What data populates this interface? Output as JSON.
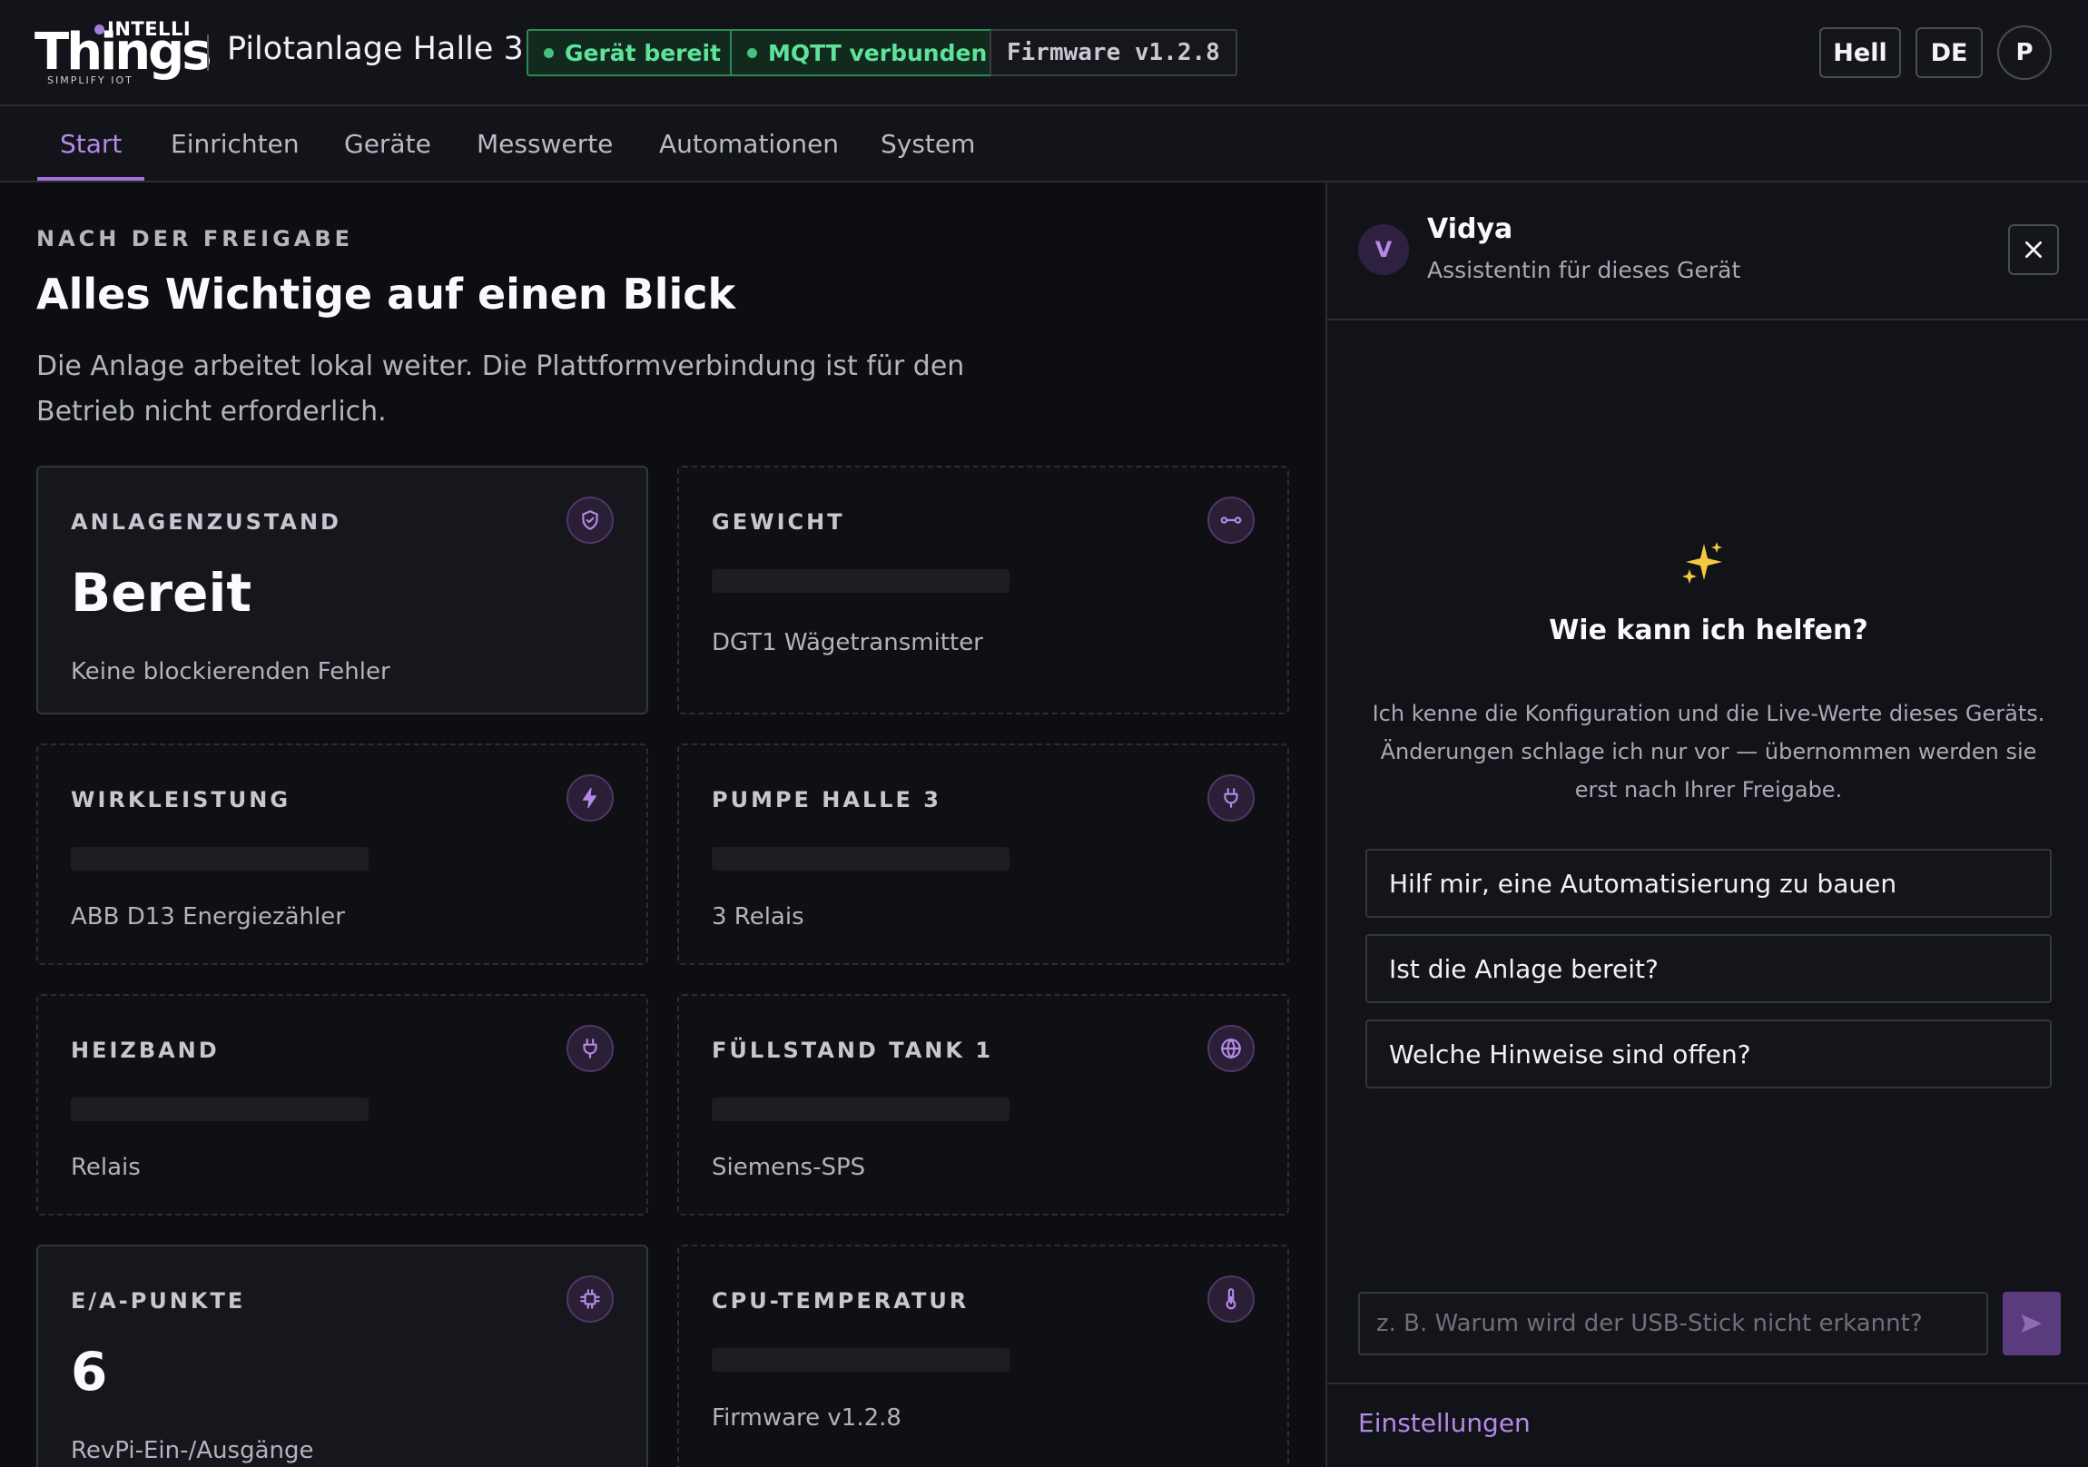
{
  "brand": {
    "top": "INTELLI",
    "main": "Things",
    "tagline": "SIMPLIFY IOT"
  },
  "header": {
    "title": "Pilotanlage Halle 3",
    "status_device": "Gerät bereit",
    "status_mqtt": "MQTT verbunden",
    "firmware": "Firmware v1.2.8",
    "theme_label": "Hell",
    "language_label": "DE",
    "user_initial": "P",
    "status_color": "#5ee39a",
    "accent_color": "#b48ae8"
  },
  "nav": {
    "tabs": [
      {
        "label": "Start",
        "active": true
      },
      {
        "label": "Einrichten",
        "active": false
      },
      {
        "label": "Geräte",
        "active": false
      },
      {
        "label": "Messwerte",
        "active": false
      },
      {
        "label": "Automationen",
        "active": false
      },
      {
        "label": "System",
        "active": false
      }
    ]
  },
  "overview": {
    "eyebrow": "NACH DER FREIGABE",
    "headline": "Alles Wichtige auf einen Blick",
    "lead": "Die Anlage arbeitet lokal weiter. Die Plattformverbindung ist für den Betrieb nicht erforderlich.",
    "cards": [
      {
        "title": "ANLAGENZUSTAND",
        "value": "Bereit",
        "subtitle": "Keine blockierenden Fehler",
        "icon": "shield-icon"
      },
      {
        "title": "GEWICHT",
        "value": "",
        "subtitle": "DGT1 Wägetransmitter",
        "icon": "scale-icon"
      },
      {
        "title": "WIRKLEISTUNG",
        "value": "",
        "subtitle": "ABB D13 Energiezähler",
        "icon": "bolt-icon"
      },
      {
        "title": "PUMPE HALLE 3",
        "value": "",
        "subtitle": "3 Relais",
        "icon": "plug-icon"
      },
      {
        "title": "HEIZBAND",
        "value": "",
        "subtitle": "Relais",
        "icon": "plug-icon"
      },
      {
        "title": "FÜLLSTAND TANK 1",
        "value": "",
        "subtitle": "Siemens-SPS",
        "icon": "globe-icon"
      },
      {
        "title": "E/A-PUNKTE",
        "value": "6",
        "subtitle": "RevPi-Ein-/Ausgänge",
        "icon": "chip-icon"
      },
      {
        "title": "CPU-TEMPERATUR",
        "value": "",
        "subtitle": "Firmware v1.2.8",
        "icon": "thermometer-icon"
      }
    ]
  },
  "assistant": {
    "avatar_initial": "V",
    "name": "Vidya",
    "role": "Assistentin für dieses Gerät",
    "greeting_title": "Wie kann ich helfen?",
    "intro": "Ich kenne die Konfiguration und die Live-Werte dieses Geräts. Änderungen schlage ich nur vor — übernommen werden sie erst nach Ihrer Freigabe.",
    "suggestions": [
      "Hilf mir, eine Automatisierung zu bauen",
      "Ist die Anlage bereit?",
      "Welche Hinweise sind offen?"
    ],
    "input_placeholder": "z. B. Warum wird der USB-Stick nicht erkannt?",
    "input_value": "",
    "settings_link": "Einstellungen"
  }
}
